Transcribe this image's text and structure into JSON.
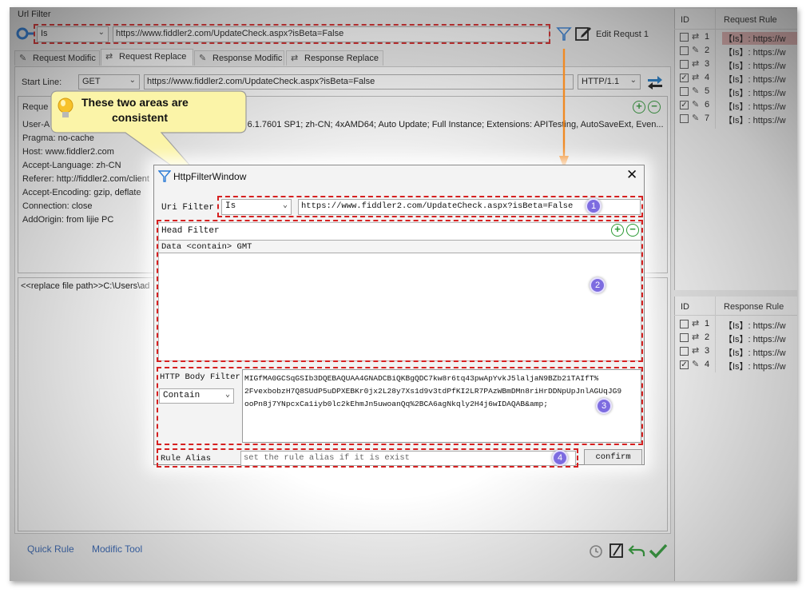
{
  "main": {
    "url_filter_title": "Url Filter",
    "match_mode": "Is",
    "url": "https://www.fiddler2.com/UpdateCheck.aspx?isBeta=False",
    "edit_label": "Edit Requst 1",
    "tabs": [
      "Request Modific",
      "Request Replace",
      "Response Modific",
      "Response Replace"
    ],
    "start_line_label": "Start Line:",
    "method": "GET",
    "request_url": "https://www.fiddler2.com/UpdateCheck.aspx?isBeta=False",
    "protocol": "HTTP/1.1",
    "headers_title": "Reque",
    "header_lines": [
      "User-A",
      "Pragma: no-cache",
      "Host: www.fiddler2.com",
      "Accept-Language: zh-CN",
      "Referer: http://fiddler2.com/client",
      "Accept-Encoding: gzip, deflate",
      "Connection: close",
      "AddOrigin: from lijie PC"
    ],
    "user_agent_tail": "T 6.1.7601 SP1; zh-CN; 4xAMD64; Auto Update; Full Instance; Extensions: APITesting, AutoSaveExt, Even...",
    "replace_text": "<<replace file path>>C:\\Users\\ad",
    "bottom_tabs": [
      "Quick Rule",
      "Modific Tool"
    ]
  },
  "callout": {
    "line1": "These two areas are",
    "line2": "consistent"
  },
  "request_rules": {
    "id_header": "ID",
    "rule_header": "Request Rule",
    "rows": [
      {
        "id": "1",
        "icon": "replace-icon",
        "checked": false,
        "text": "【Is】: https://w"
      },
      {
        "id": "2",
        "icon": "pencil-icon",
        "checked": false,
        "text": "【Is】: https://w"
      },
      {
        "id": "3",
        "icon": "replace-icon",
        "checked": false,
        "text": "【Is】: https://w"
      },
      {
        "id": "4",
        "icon": "replace-icon",
        "checked": true,
        "text": "【Is】: https://w"
      },
      {
        "id": "5",
        "icon": "pencil-icon",
        "checked": false,
        "text": "【Is】: https://w"
      },
      {
        "id": "6",
        "icon": "pencil-icon",
        "checked": true,
        "text": "【Is】: https://w"
      },
      {
        "id": "7",
        "icon": "pencil-icon",
        "checked": false,
        "text": "【Is】: https://w"
      }
    ]
  },
  "response_rules": {
    "id_header": "ID",
    "rule_header": "Response Rule",
    "rows": [
      {
        "id": "1",
        "icon": "replace-icon",
        "checked": false,
        "text": "【Is】: https://w"
      },
      {
        "id": "2",
        "icon": "replace-icon",
        "checked": false,
        "text": "【Is】: https://w"
      },
      {
        "id": "3",
        "icon": "replace-icon",
        "checked": false,
        "text": "【Is】: https://w"
      },
      {
        "id": "4",
        "icon": "pencil-icon",
        "checked": true,
        "text": "【Is】: https://w"
      }
    ]
  },
  "dialog": {
    "title": "HttpFilterWindow",
    "uri_filter_label": "Uri Filter",
    "match_mode": "Is",
    "url": "https://www.fiddler2.com/UpdateCheck.aspx?isBeta=False",
    "head_filter_label": "Head Filter",
    "head_filter_row": "Data  <contain> GMT",
    "body_filter_label": "HTTP Body Filter",
    "body_filter_mode": "Contain",
    "body_text": [
      "MIGfMA0GCSqGSIb3DQEBAQUAA4GNADCBiQKBgQDC7kw8r6tq43pwApYvkJ5laljaN9BZb21TAIfT%",
      "2FvexbobzH7Q8SUdP5uDPXEBKr0jx2L28y7Xs1d9v3tdPfKI2LR7PAzWBmDMn8riHrDDNpUpJnlAGUqJG9",
      "ooPn8j7YNpcxCa1iyb0lc2kEhmJn5uwoanQq%2BCA6agNkqly2H4j6wIDAQAB&amp;"
    ],
    "rule_alias_label": "Rule Alias",
    "rule_alias_placeholder": "set the rule alias if it is exist",
    "confirm_label": "confirm",
    "badges": [
      "1",
      "2",
      "3",
      "4"
    ]
  },
  "colors": {
    "annotation_red": "#d62020",
    "arrow_orange": "#f08a24",
    "badge_purple": "#7d6ce0",
    "callout_yellow": "#fbf4a8",
    "link_blue": "#2a5db0",
    "add_green": "#2c9a35"
  }
}
